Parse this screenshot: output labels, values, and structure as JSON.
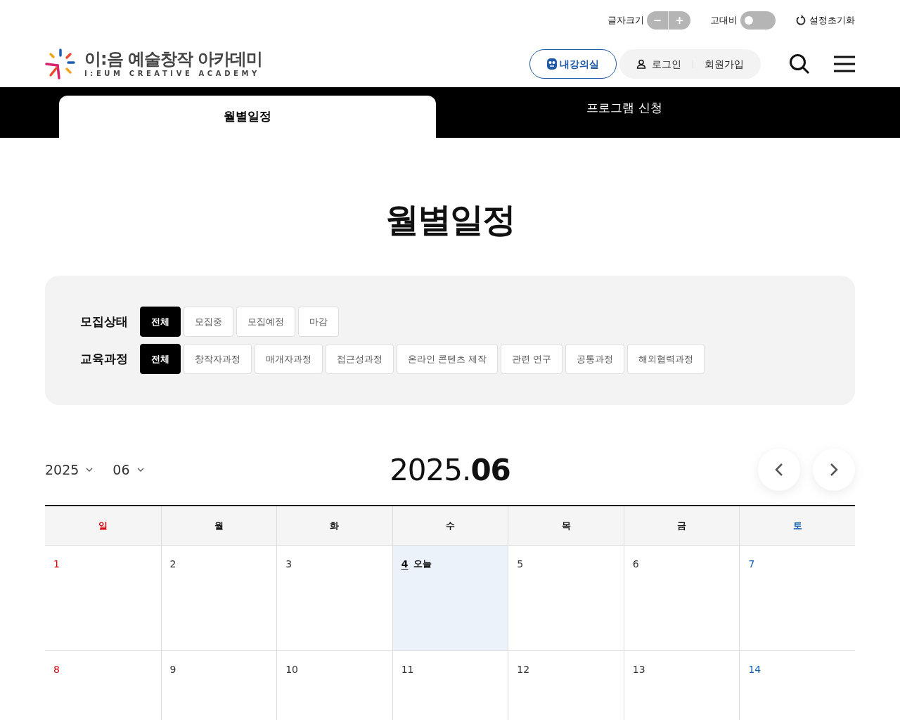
{
  "utility_bar": {
    "font_size": {
      "label": "글자크기",
      "decrease": "−",
      "increase": "+"
    },
    "contrast": {
      "label": "고대비",
      "on": false
    },
    "reset": {
      "label": "설정초기화"
    }
  },
  "header": {
    "logo": {
      "title": "이:음 예술창작 아카데미",
      "subtitle": "I:EUM CREATIVE ACADEMY"
    },
    "classroom_button": "내강의실",
    "login": "로그인",
    "signup": "회원가입"
  },
  "tabs": [
    {
      "label": "월별일정",
      "selected": true
    },
    {
      "label": "프로그램 신청",
      "selected": false
    }
  ],
  "page_title": "월별일정",
  "filters": [
    {
      "label": "모집상태",
      "options": [
        {
          "label": "전체",
          "selected": true
        },
        {
          "label": "모집중",
          "selected": false
        },
        {
          "label": "모집예정",
          "selected": false
        },
        {
          "label": "마감",
          "selected": false
        }
      ]
    },
    {
      "label": "교육과정",
      "options": [
        {
          "label": "전체",
          "selected": true
        },
        {
          "label": "창작자과정",
          "selected": false
        },
        {
          "label": "매개자과정",
          "selected": false
        },
        {
          "label": "접근성과정",
          "selected": false
        },
        {
          "label": "온라인 콘텐츠 제작",
          "selected": false
        },
        {
          "label": "관련 연구",
          "selected": false
        },
        {
          "label": "공통과정",
          "selected": false
        },
        {
          "label": "해외협력과정",
          "selected": false
        }
      ]
    }
  ],
  "calendar": {
    "year_select": "2025",
    "month_select": "06",
    "title": "2025.**06**",
    "weekdays": [
      {
        "label": "일",
        "color": "#d7000f"
      },
      {
        "label": "월",
        "color": "#111111"
      },
      {
        "label": "화",
        "color": "#111111"
      },
      {
        "label": "수",
        "color": "#111111"
      },
      {
        "label": "목",
        "color": "#111111"
      },
      {
        "label": "금",
        "color": "#111111"
      },
      {
        "label": "토",
        "color": "#0b5cad"
      }
    ],
    "weeks": [
      [
        {
          "day": "1",
          "color": "#d7000f",
          "today": false
        },
        {
          "day": "2",
          "color": "#333333",
          "today": false
        },
        {
          "day": "3",
          "color": "#333333",
          "today": false
        },
        {
          "day": "4",
          "color": "#111111",
          "today": true,
          "today_label": "오늘"
        },
        {
          "day": "5",
          "color": "#333333",
          "today": false
        },
        {
          "day": "6",
          "color": "#333333",
          "today": false
        },
        {
          "day": "7",
          "color": "#0b5cad",
          "today": false
        }
      ],
      [
        {
          "day": "8",
          "color": "#d7000f",
          "today": false
        },
        {
          "day": "9",
          "color": "#333333",
          "today": false
        },
        {
          "day": "10",
          "color": "#333333",
          "today": false
        },
        {
          "day": "11",
          "color": "#333333",
          "today": false
        },
        {
          "day": "12",
          "color": "#333333",
          "today": false
        },
        {
          "day": "13",
          "color": "#333333",
          "today": false
        },
        {
          "day": "14",
          "color": "#0b5cad",
          "today": false
        }
      ]
    ]
  }
}
